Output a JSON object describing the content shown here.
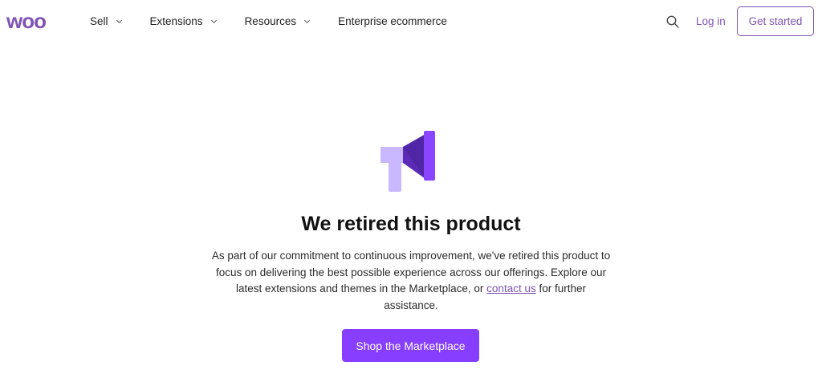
{
  "header": {
    "logo_text": "woo",
    "nav": [
      {
        "label": "Sell",
        "has_dropdown": true
      },
      {
        "label": "Extensions",
        "has_dropdown": true
      },
      {
        "label": "Resources",
        "has_dropdown": true
      },
      {
        "label": "Enterprise ecommerce",
        "has_dropdown": false
      }
    ],
    "search_icon": "search-icon",
    "login_label": "Log in",
    "get_started_label": "Get started"
  },
  "main": {
    "icon": "megaphone-icon",
    "title": "We retired this product",
    "description_before": "As part of our commitment to continuous improvement, we've retired this product to focus on delivering the best possible experience across our offerings. Explore our latest extensions and themes in the Marketplace, or ",
    "contact_link": "contact us",
    "description_after": " for further assistance.",
    "cta_label": "Shop the Marketplace"
  },
  "colors": {
    "brand": "#7f54b3",
    "cta": "#873eff",
    "icon_light": "#c9b8ff",
    "icon_dark": "#5b2bb8",
    "icon_mid": "#8a45ff"
  }
}
